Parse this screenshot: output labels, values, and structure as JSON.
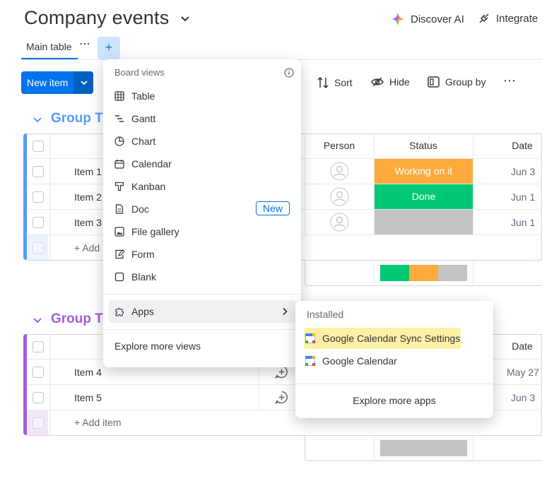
{
  "board": {
    "title": "Company events",
    "actions": {
      "discover_ai": "Discover AI",
      "integrate": "Integrate"
    },
    "tabs": {
      "main": "Main table",
      "more": "⋯",
      "add": "+"
    }
  },
  "toolbar": {
    "new_item": "New item",
    "sort": "Sort",
    "hide": "Hide",
    "group_by": "Group by",
    "more": "⋯"
  },
  "groups": [
    {
      "title": "Group Th",
      "color": "#579bfc",
      "columns": {
        "person": "Person",
        "status": "Status",
        "date": "Date"
      },
      "items": [
        {
          "name": "Item 1",
          "status": "Working on it",
          "status_color": "#fdab3d",
          "date": "Jun 3"
        },
        {
          "name": "Item 2",
          "status": "Done",
          "status_color": "#00c875",
          "date": "Jun 1"
        },
        {
          "name": "Item 3",
          "status": "",
          "status_color": "#c4c4c4",
          "date": "Jun 1"
        }
      ],
      "add_item": "+ Add"
    },
    {
      "title": "Group Th",
      "color": "#a25ddc",
      "columns": {
        "date": "Date"
      },
      "items": [
        {
          "name": "Item 4",
          "date": "May 27"
        },
        {
          "name": "Item 5",
          "date": "Jun 3"
        }
      ],
      "add_item": "+ Add item"
    }
  ],
  "menu": {
    "heading": "Board views",
    "views": [
      {
        "label": "Table",
        "icon": "table-icon"
      },
      {
        "label": "Gantt",
        "icon": "gantt-icon"
      },
      {
        "label": "Chart",
        "icon": "chart-icon"
      },
      {
        "label": "Calendar",
        "icon": "calendar-icon"
      },
      {
        "label": "Kanban",
        "icon": "kanban-icon"
      },
      {
        "label": "Doc",
        "icon": "doc-icon"
      },
      {
        "label": "File gallery",
        "icon": "file-gallery-icon"
      },
      {
        "label": "Form",
        "icon": "form-icon"
      },
      {
        "label": "Blank",
        "icon": "blank-icon"
      }
    ],
    "new_badge": "New",
    "apps": "Apps",
    "explore_views": "Explore more views"
  },
  "submenu": {
    "heading": "Installed",
    "apps": [
      {
        "label": "Google Calendar Sync Settings",
        "highlighted": true
      },
      {
        "label": "Google Calendar",
        "highlighted": false
      }
    ],
    "explore_apps": "Explore more apps",
    "highlight_color": "#fdf1a7"
  }
}
